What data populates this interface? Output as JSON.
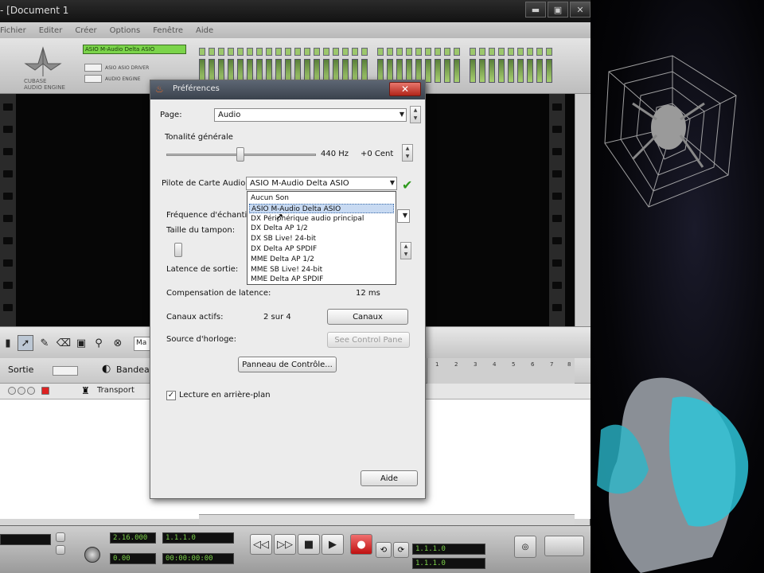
{
  "window": {
    "title": "- [Document 1",
    "menu": [
      "Fichier",
      "Editer",
      "Créer",
      "Options",
      "Fenêtre",
      "Aide"
    ],
    "buttons": {
      "minimize": "▬",
      "maximize": "▣",
      "close": "✕"
    }
  },
  "top_panel": {
    "lcd_text": "ASIO M-Audio Delta ASIO",
    "logo_caption_1": "CUBASE",
    "logo_caption_2": "AUDIO ENGINE",
    "mini_label_1": "ASIO ASIO DRIVER",
    "mini_label_2": "AUDIO ENGINE"
  },
  "toolbar": {
    "mode_field": "Ma",
    "tools": [
      "pointer-tool",
      "pencil-tool",
      "eraser-tool",
      "zoom-tool",
      "mute-tool"
    ]
  },
  "tracks": {
    "header_labels": [
      "Sortie",
      "Bandeau"
    ],
    "ruler_ticks": [
      "1",
      "2",
      "3",
      "4",
      "5",
      "6",
      "7",
      "8"
    ],
    "rows": [
      {
        "name": "Transport"
      }
    ]
  },
  "transport": {
    "display_1": "2.16.000",
    "display_2": "0.00",
    "display_3": "00:00:00:00",
    "display_4": "1.1.1.0",
    "display_5": "1.1.1.0",
    "display_6": "1.1.1.0"
  },
  "dialog": {
    "title": "Préférences",
    "page_label": "Page:",
    "page_value": "Audio",
    "tonality_label": "Tonalité générale",
    "tonality_hz": "440 Hz",
    "tonality_cent": "+0 Cent",
    "driver_label": "Pilote de Carte Audio:",
    "driver_value": "ASIO M-Audio Delta ASIO",
    "samplerate_label": "Fréquence d'échantil",
    "buffer_label": "Taille du tampon:",
    "latency_label": "Latence de sortie:",
    "latency_comp_label": "Compensation de latence:",
    "latency_comp_value": "12 ms",
    "active_channels_label": "Canaux actifs:",
    "active_channels_value": "2 sur 4",
    "channels_button": "Canaux",
    "clock_source_label": "Source d'horloge:",
    "clock_source_value": "See Control Pane",
    "control_panel_button": "Panneau de Contrôle...",
    "background_play_label": "Lecture en arrière-plan",
    "background_play_checked": true,
    "help_button": "Aide",
    "driver_options": [
      "Aucun Son",
      "ASIO M-Audio Delta ASIO",
      "DX Périphérique audio principal",
      "DX Delta AP 1/2",
      "DX SB Live! 24-bit",
      "DX Delta AP SPDIF",
      "MME Delta AP 1/2",
      "MME SB Live! 24-bit",
      "MME Delta AP SPDIF"
    ],
    "driver_selected_index": 1
  },
  "colors": {
    "accent_green": "#7bd44a",
    "dialog_bg": "#ececec",
    "title_close": "#b1251a",
    "selection": "#c8daf2"
  }
}
